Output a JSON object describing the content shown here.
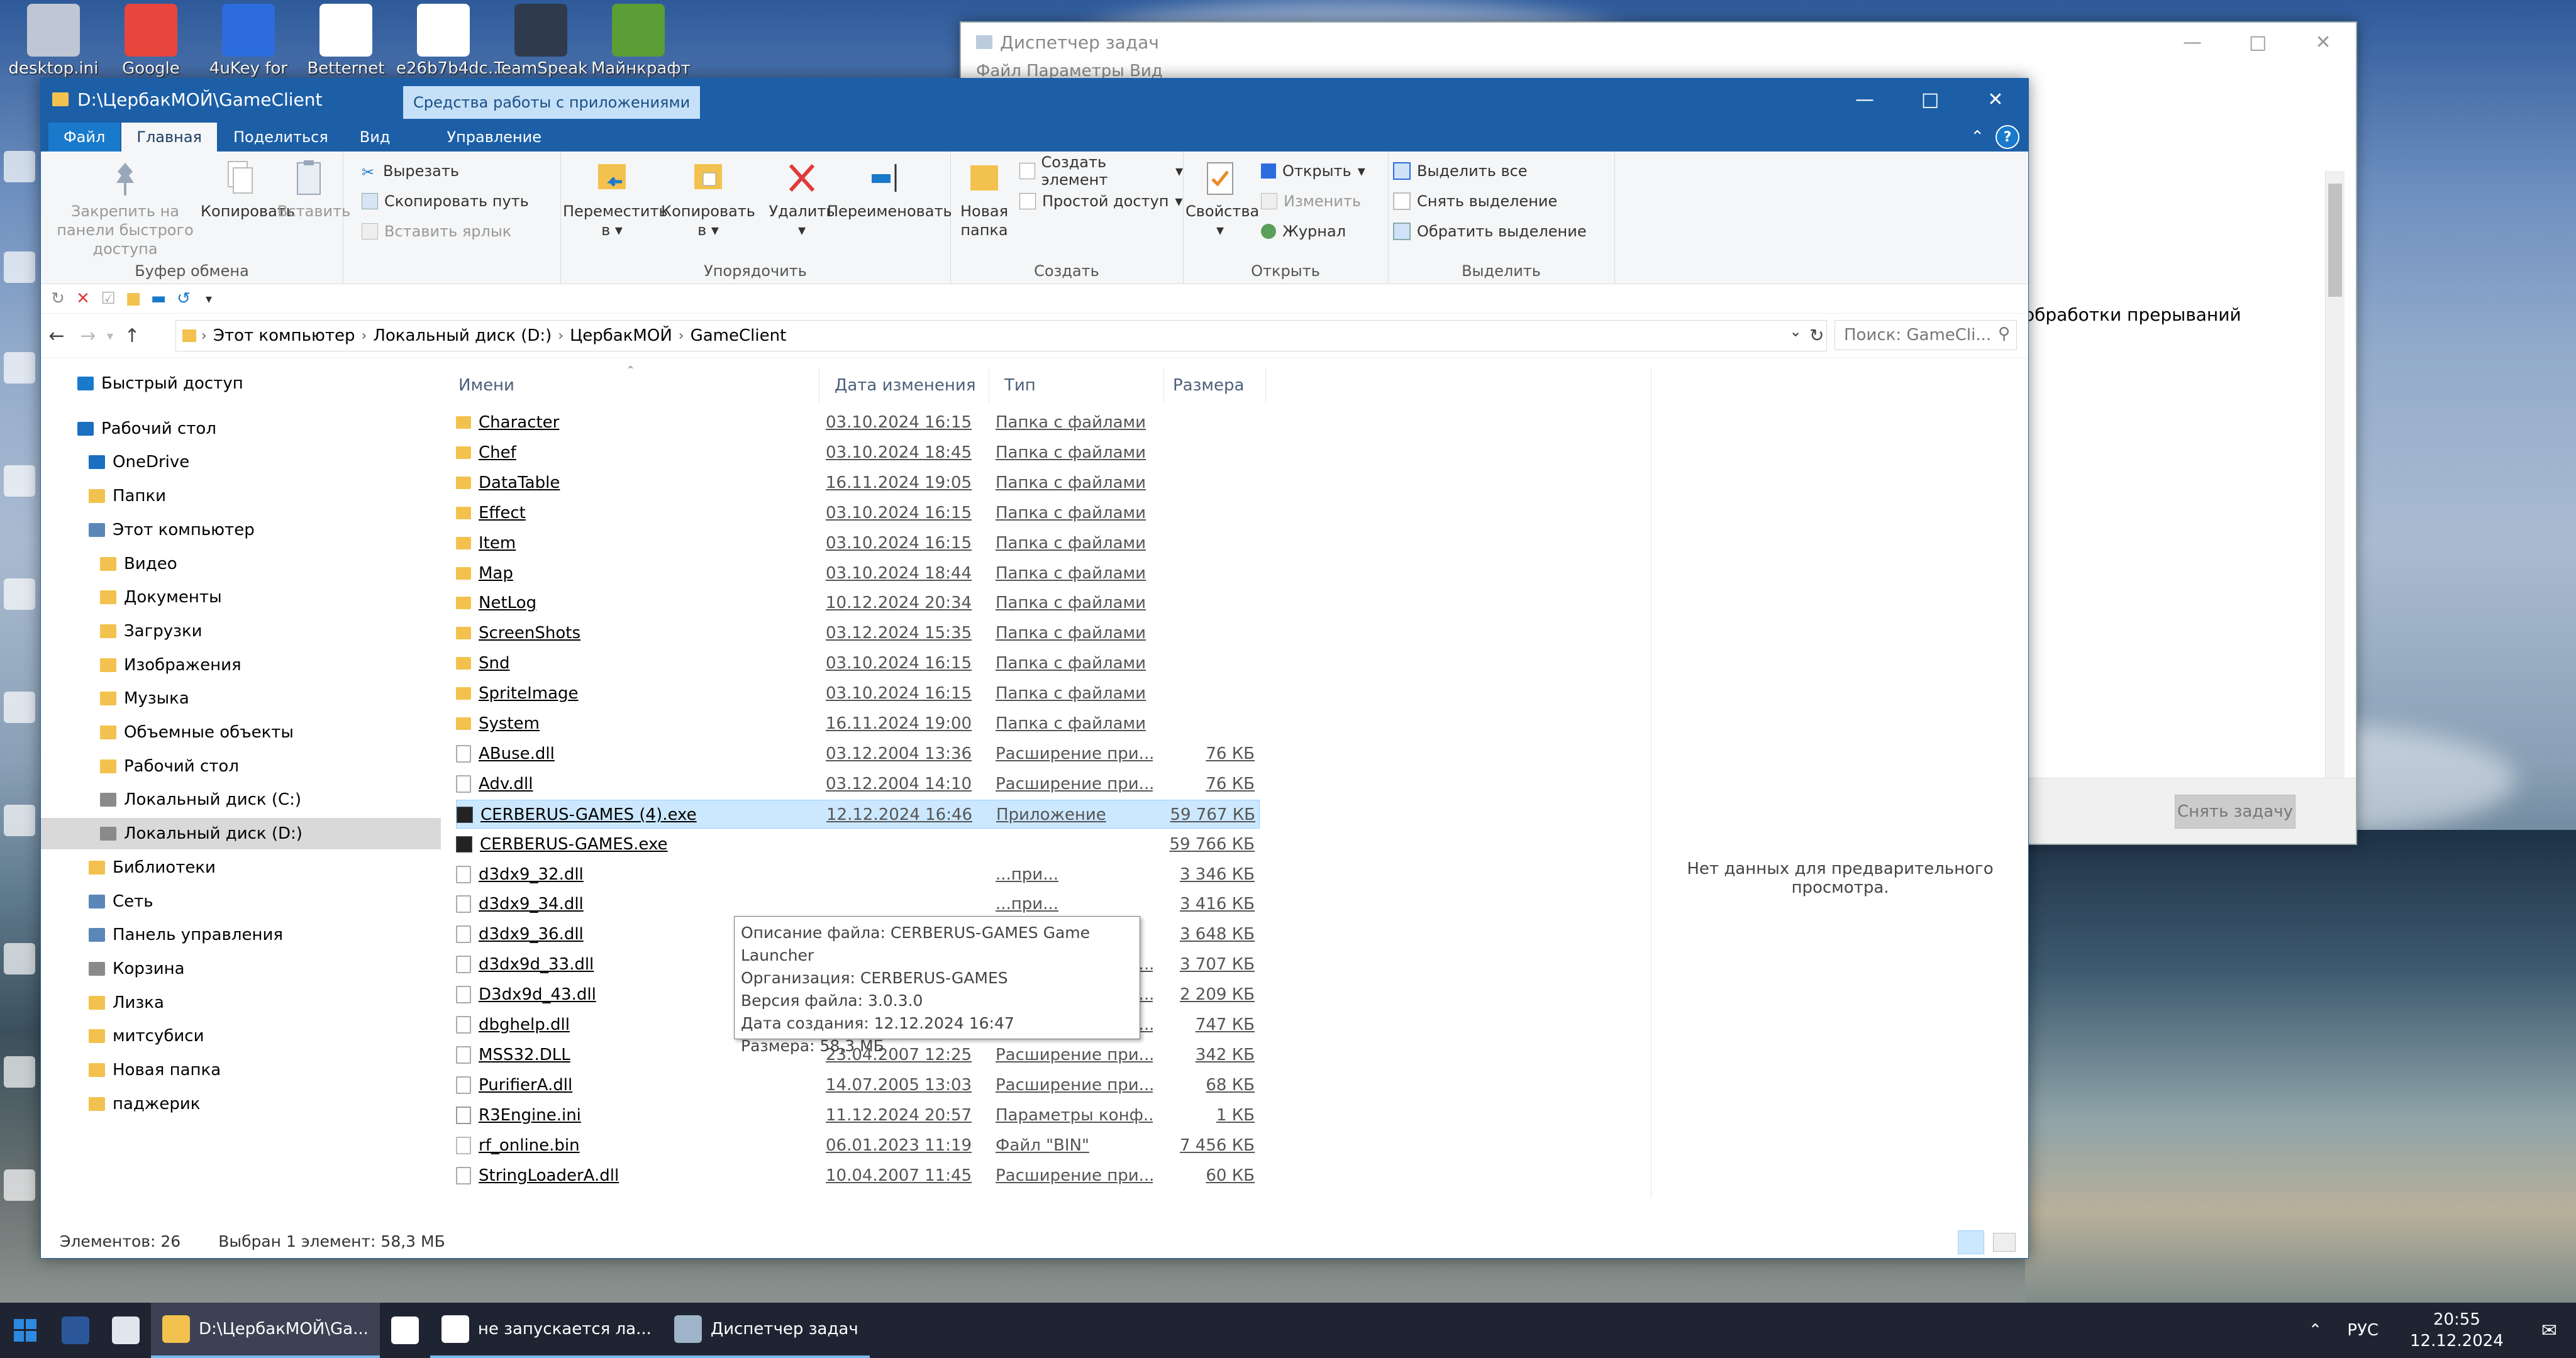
{
  "desktop": {
    "icons": [
      {
        "label": "desktop.ini",
        "color": "#bfc7d4"
      },
      {
        "label": "Google",
        "color": "#e8453c"
      },
      {
        "label": "4uKey for",
        "color": "#2d6cdf"
      },
      {
        "label": "Betternet",
        "color": "#ffffff"
      },
      {
        "label": "e26b7b4dc...",
        "color": "#ffffff"
      },
      {
        "label": "TeamSpeak 3",
        "color": "#2f3b4c"
      },
      {
        "label": "Майнкрафт",
        "color": "#5a9e35"
      }
    ]
  },
  "taskmgr": {
    "title": "Диспетчер задач",
    "menu": "Файл  Параметры  Вид",
    "partial_text": "обработки прерываний",
    "end_task": "Снять задачу"
  },
  "explorer": {
    "title": "D:\\ЦербакМОЙ\\GameClient",
    "context_tab": "Средства работы с приложениями",
    "tabs": {
      "file": "Файл",
      "home": "Главная",
      "share": "Поделиться",
      "view": "Вид",
      "manage": "Управление"
    },
    "ribbon": {
      "pin": "Закрепить на панели быстрого доступа",
      "copy": "Копировать",
      "paste": "Вставить",
      "cut": "Вырезать",
      "copy_path": "Скопировать путь",
      "paste_shortcut": "Вставить ярлык",
      "clipboard": "Буфер обмена",
      "move_to": "Переместить в",
      "copy_to": "Копировать в",
      "delete": "Удалить",
      "rename": "Переименовать",
      "organize": "Упорядочить",
      "new_folder": "Новая папка",
      "new_item": "Создать элемент",
      "easy_access": "Простой доступ",
      "create": "Создать",
      "properties": "Свойства",
      "open": "Открыть",
      "edit": "Изменить",
      "history": "Журнал",
      "open_group": "Открыть",
      "select_all": "Выделить все",
      "select_none": "Снять выделение",
      "invert": "Обратить выделение",
      "select_group": "Выделить"
    },
    "address": {
      "crumbs": [
        "Этот компьютер",
        "Локальный диск (D:)",
        "ЦербакМОЙ",
        "GameClient"
      ],
      "search_placeholder": "Поиск: GameCli..."
    },
    "nav": [
      {
        "label": "Быстрый доступ",
        "indent": 0,
        "color": "#1979ca"
      },
      {
        "label": "Рабочий стол",
        "indent": 0,
        "color": "#1a6fc0"
      },
      {
        "label": "OneDrive",
        "indent": 1,
        "color": "#1a6fc0"
      },
      {
        "label": "Папки",
        "indent": 1,
        "color": "#f3c24e"
      },
      {
        "label": "Этот компьютер",
        "indent": 1,
        "color": "#5a87b8"
      },
      {
        "label": "Видео",
        "indent": 2,
        "color": "#f3c24e"
      },
      {
        "label": "Документы",
        "indent": 2,
        "color": "#f3c24e"
      },
      {
        "label": "Загрузки",
        "indent": 2,
        "color": "#f3c24e"
      },
      {
        "label": "Изображения",
        "indent": 2,
        "color": "#f3c24e"
      },
      {
        "label": "Музыка",
        "indent": 2,
        "color": "#f3c24e"
      },
      {
        "label": "Объемные объекты",
        "indent": 2,
        "color": "#f3c24e"
      },
      {
        "label": "Рабочий стол",
        "indent": 2,
        "color": "#f3c24e"
      },
      {
        "label": "Локальный диск (C:)",
        "indent": 2,
        "color": "#8a8a8a"
      },
      {
        "label": "Локальный диск (D:)",
        "indent": 2,
        "color": "#8a8a8a",
        "selected": true
      },
      {
        "label": "Библиотеки",
        "indent": 1,
        "color": "#f3c24e"
      },
      {
        "label": "Сеть",
        "indent": 1,
        "color": "#5a87b8"
      },
      {
        "label": "Панель управления",
        "indent": 1,
        "color": "#5a87b8"
      },
      {
        "label": "Корзина",
        "indent": 1,
        "color": "#8a8a8a"
      },
      {
        "label": "Лизка",
        "indent": 1,
        "color": "#f3c24e"
      },
      {
        "label": "митсубиси",
        "indent": 1,
        "color": "#f3c24e"
      },
      {
        "label": "Новая папка",
        "indent": 1,
        "color": "#f3c24e"
      },
      {
        "label": "паджерик",
        "indent": 1,
        "color": "#f3c24e"
      }
    ],
    "columns": {
      "name": "Имени",
      "date": "Дата изменения",
      "type": "Тип",
      "size": "Размера"
    },
    "files": [
      {
        "name": "Character",
        "date": "03.10.2024 16:15",
        "type": "Папка с файлами",
        "size": "",
        "kind": "folder"
      },
      {
        "name": "Chef",
        "date": "03.10.2024 18:45",
        "type": "Папка с файлами",
        "size": "",
        "kind": "folder"
      },
      {
        "name": "DataTable",
        "date": "16.11.2024 19:05",
        "type": "Папка с файлами",
        "size": "",
        "kind": "folder"
      },
      {
        "name": "Effect",
        "date": "03.10.2024 16:15",
        "type": "Папка с файлами",
        "size": "",
        "kind": "folder"
      },
      {
        "name": "Item",
        "date": "03.10.2024 16:15",
        "type": "Папка с файлами",
        "size": "",
        "kind": "folder"
      },
      {
        "name": "Map",
        "date": "03.10.2024 18:44",
        "type": "Папка с файлами",
        "size": "",
        "kind": "folder"
      },
      {
        "name": "NetLog",
        "date": "10.12.2024 20:34",
        "type": "Папка с файлами",
        "size": "",
        "kind": "folder"
      },
      {
        "name": "ScreenShots",
        "date": "03.12.2024 15:35",
        "type": "Папка с файлами",
        "size": "",
        "kind": "folder"
      },
      {
        "name": "Snd",
        "date": "03.10.2024 16:15",
        "type": "Папка с файлами",
        "size": "",
        "kind": "folder"
      },
      {
        "name": "SpriteImage",
        "date": "03.10.2024 16:15",
        "type": "Папка с файлами",
        "size": "",
        "kind": "folder"
      },
      {
        "name": "System",
        "date": "16.11.2024 19:00",
        "type": "Папка с файлами",
        "size": "",
        "kind": "folder"
      },
      {
        "name": "ABuse.dll",
        "date": "03.12.2004 13:36",
        "type": "Расширение при...",
        "size": "76 КБ",
        "kind": "dll"
      },
      {
        "name": "Adv.dll",
        "date": "03.12.2004 14:10",
        "type": "Расширение при...",
        "size": "76 КБ",
        "kind": "dll"
      },
      {
        "name": "CERBERUS-GAMES (4).exe",
        "date": "12.12.2024 16:46",
        "type": "Приложение",
        "size": "59 767 КБ",
        "kind": "exe",
        "selected": true
      },
      {
        "name": "CERBERUS-GAMES.exe",
        "date": "",
        "type": "",
        "size": "59 766 КБ",
        "kind": "exe"
      },
      {
        "name": "d3dx9_32.dll",
        "date": "",
        "type": "...при...",
        "size": "3 346 КБ",
        "kind": "dll"
      },
      {
        "name": "d3dx9_34.dll",
        "date": "",
        "type": "...при...",
        "size": "3 416 КБ",
        "kind": "dll"
      },
      {
        "name": "d3dx9_36.dll",
        "date": "",
        "type": "...при...",
        "size": "3 648 КБ",
        "kind": "dll"
      },
      {
        "name": "d3dx9d_33.dll",
        "date": "02.06.2010 13:23",
        "type": "Расширение при...",
        "size": "3 707 КБ",
        "kind": "dll"
      },
      {
        "name": "D3dx9d_43.dll",
        "date": "02.06.2010 13:23",
        "type": "Расширение при...",
        "size": "2 209 КБ",
        "kind": "dll"
      },
      {
        "name": "dbghelp.dll",
        "date": "23.04.2007 12:25",
        "type": "Расширение при...",
        "size": "747 КБ",
        "kind": "dll"
      },
      {
        "name": "MSS32.DLL",
        "date": "23.04.2007 12:25",
        "type": "Расширение при...",
        "size": "342 КБ",
        "kind": "dll"
      },
      {
        "name": "PurifierA.dll",
        "date": "14.07.2005 13:03",
        "type": "Расширение при...",
        "size": "68 КБ",
        "kind": "dll"
      },
      {
        "name": "R3Engine.ini",
        "date": "11.12.2024 20:57",
        "type": "Параметры конф...",
        "size": "1 КБ",
        "kind": "ini"
      },
      {
        "name": "rf_online.bin",
        "date": "06.01.2023 11:19",
        "type": "Файл \"BIN\"",
        "size": "7 456 КБ",
        "kind": "bin"
      },
      {
        "name": "StringLoaderA.dll",
        "date": "10.04.2007 11:45",
        "type": "Расширение при...",
        "size": "60 КБ",
        "kind": "dll"
      }
    ],
    "preview_text": "Нет данных для предварительного просмотра.",
    "tooltip": [
      "Описание файла: CERBERUS-GAMES Game Launcher",
      "Организация: CERBERUS-GAMES",
      "Версия файла: 3.0.3.0",
      "Дата создания: 12.12.2024 16:47",
      "Размера: 58,3 МБ"
    ],
    "status": {
      "count": "Элементов: 26",
      "selected": "Выбран 1 элемент: 58,3 МБ"
    }
  },
  "taskbar": {
    "items": [
      {
        "label": "",
        "icon": "word-icon",
        "color": "#2b579a"
      },
      {
        "label": "",
        "icon": "window-icon",
        "color": "#dfe6ee"
      },
      {
        "label": "D:\\ЦербакМОЙ\\Ga...",
        "icon": "folder-icon",
        "color": "#f3c24e",
        "state": "active"
      },
      {
        "label": "",
        "icon": "yandex-icon",
        "color": "#ffffff"
      },
      {
        "label": "не запускается ла...",
        "icon": "yandex-icon",
        "color": "#ffffff",
        "state": "open"
      },
      {
        "label": "Диспетчер задач",
        "icon": "taskmgr-icon",
        "color": "#9fb4c8",
        "state": "open"
      }
    ],
    "lang": "РУС",
    "time": "20:55",
    "date": "12.12.2024"
  }
}
